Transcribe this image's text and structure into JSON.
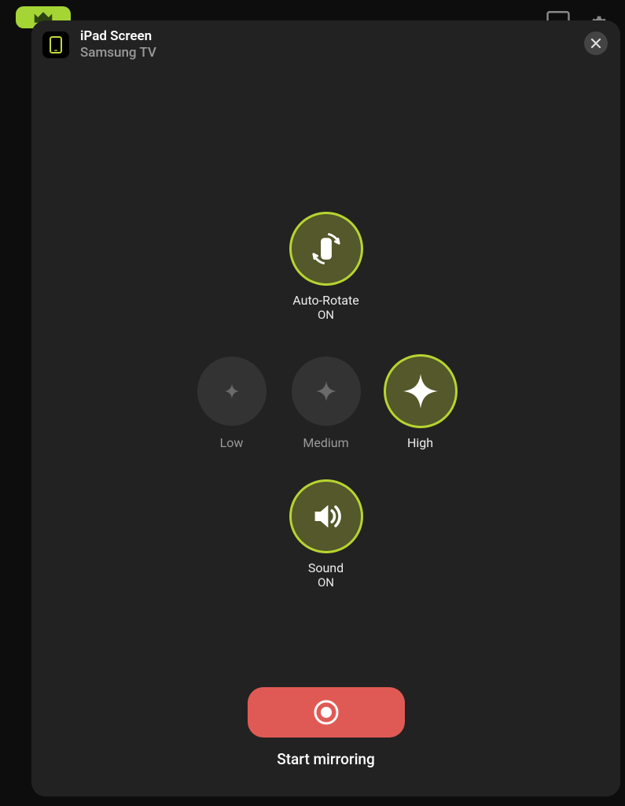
{
  "header": {
    "title": "iPad Screen",
    "subtitle": "Samsung TV"
  },
  "autoRotate": {
    "label": "Auto-Rotate",
    "state": "ON"
  },
  "quality": {
    "low": "Low",
    "medium": "Medium",
    "high": "High",
    "selected": "High"
  },
  "sound": {
    "label": "Sound",
    "state": "ON"
  },
  "action": {
    "label": "Start mirroring"
  }
}
